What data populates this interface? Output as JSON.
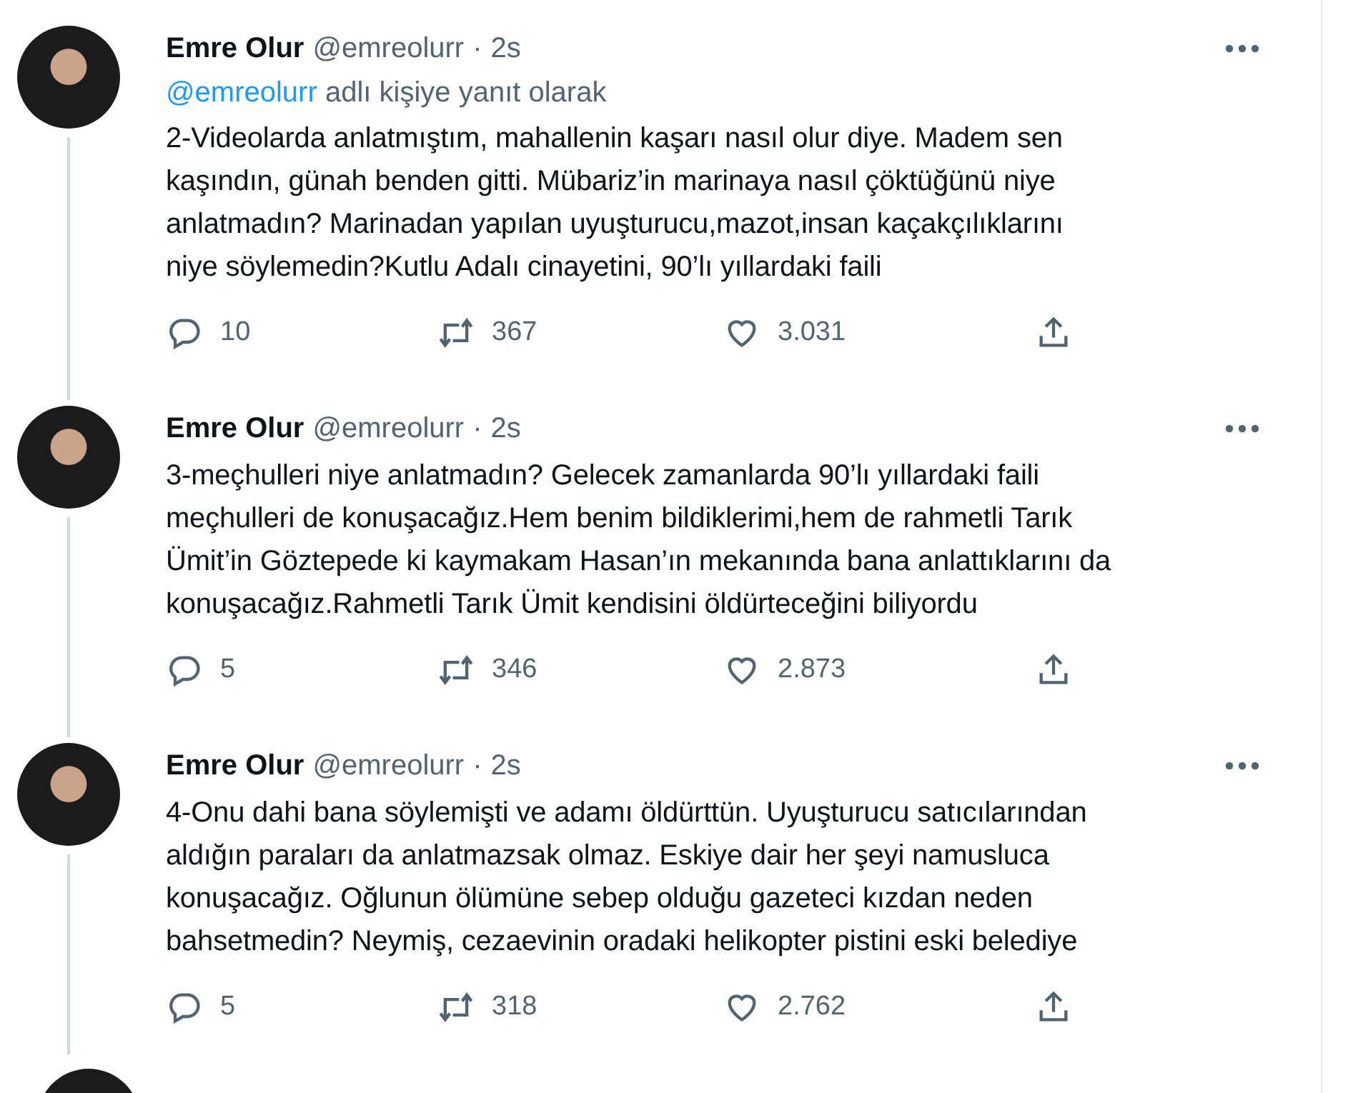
{
  "tweets": [
    {
      "name": "Emre Olur",
      "handle": "@emreolurr",
      "separator": "·",
      "time": "2s",
      "reply_to": {
        "handle": "@emreolurr",
        "text": "adlı kişiye yanıt olarak"
      },
      "lines": [
        "2-Videolarda anlatmıştım, mahallenin kaşarı nasıl olur diye. Madem sen",
        "kaşındın, günah benden gitti. Mübariz’in marinaya nasıl çöktüğünü niye",
        "anlatmadın? Marinadan yapılan uyuşturucu,mazot,insan kaçakçılıklarını",
        "niye söylemedin?Kutlu Adalı cinayetini, 90’lı yıllardaki faili"
      ],
      "replies": "10",
      "retweets": "367",
      "likes": "3.031"
    },
    {
      "name": "Emre Olur",
      "handle": "@emreolurr",
      "separator": "·",
      "time": "2s",
      "lines": [
        "3-meçhulleri niye anlatmadın? Gelecek zamanlarda 90’lı yıllardaki faili",
        "meçhulleri de konuşacağız.Hem benim bildiklerimi,hem de rahmetli Tarık",
        "Ümit’in Göztepede ki kaymakam Hasan’ın mekanında bana anlattıklarını da",
        "konuşacağız.Rahmetli Tarık Ümit kendisini öldürteceğini biliyordu"
      ],
      "replies": "5",
      "retweets": "346",
      "likes": "2.873"
    },
    {
      "name": "Emre Olur",
      "handle": "@emreolurr",
      "separator": "·",
      "time": "2s",
      "lines": [
        "4-Onu dahi bana söylemişti ve adamı öldürttün. Uyuşturucu satıcılarından",
        "aldığın paraları da anlatmazsak olmaz. Eskiye dair her şeyi namusluca",
        "konuşacağız. Oğlunun ölümüne sebep olduğu gazeteci kızdan neden",
        "bahsetmedin? Neymiş, cezaevinin oradaki helikopter pistini eski belediye"
      ],
      "replies": "5",
      "retweets": "318",
      "likes": "2.762"
    }
  ]
}
